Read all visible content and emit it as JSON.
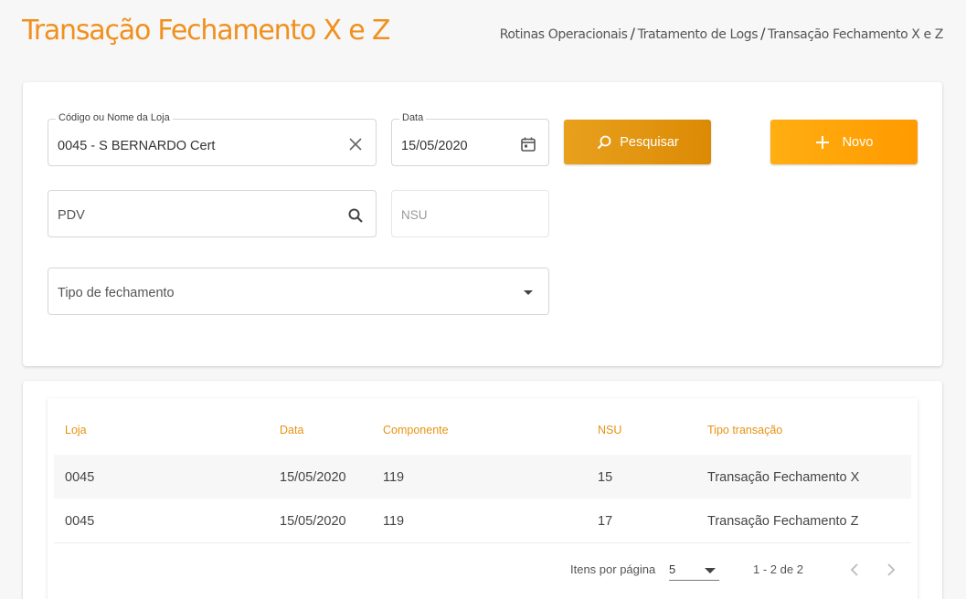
{
  "header": {
    "title": "Transação Fechamento X e Z",
    "breadcrumb": [
      "Rotinas Operacionais",
      "Tratamento de Logs",
      "Transação Fechamento X e Z"
    ],
    "separator": "/"
  },
  "filters": {
    "store": {
      "label": "Código ou Nome da Loja",
      "value": "0045 - S BERNARDO Cert",
      "clear_icon": "close-icon"
    },
    "date": {
      "label": "Data",
      "value": "15/05/2020",
      "icon": "calendar-icon"
    },
    "pdv": {
      "placeholder": "PDV",
      "icon": "search-icon"
    },
    "nsu": {
      "placeholder": "NSU"
    },
    "closing_type": {
      "placeholder": "Tipo de fechamento",
      "icon": "arrow-drop-down-icon"
    },
    "search_button": {
      "label": "Pesquisar",
      "icon": "search-icon"
    },
    "new_button": {
      "label": "Novo",
      "icon": "plus-icon"
    }
  },
  "table": {
    "columns": [
      "Loja",
      "Data",
      "Componente",
      "NSU",
      "Tipo transação"
    ],
    "rows": [
      [
        "0045",
        "15/05/2020",
        "119",
        "15",
        "Transação Fechamento X"
      ],
      [
        "0045",
        "15/05/2020",
        "119",
        "17",
        "Transação Fechamento Z"
      ]
    ]
  },
  "paginator": {
    "items_label": "Itens por página",
    "page_size": "5",
    "range": "1 - 2 de 2",
    "prev_icon": "chevron-left-icon",
    "next_icon": "chevron-right-icon"
  },
  "colors": {
    "accent": "#f0901e",
    "search_button": "#e39614",
    "new_button": "#ffa40a",
    "header_text": "#e79212"
  }
}
